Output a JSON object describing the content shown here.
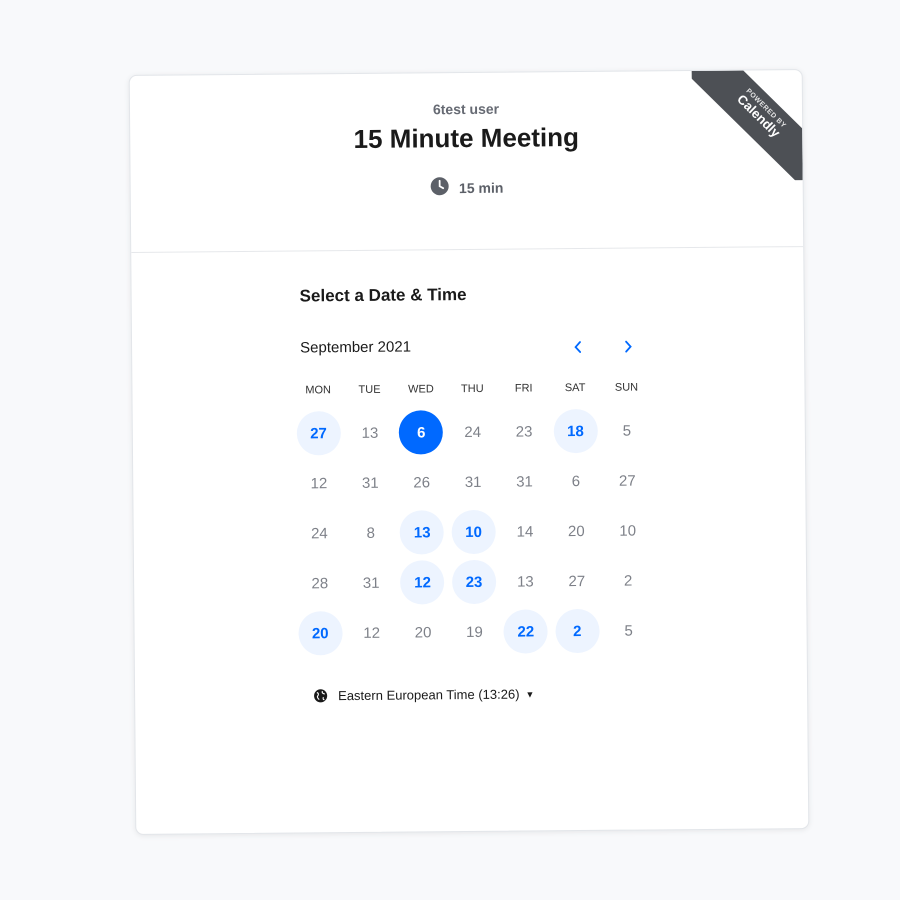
{
  "event": {
    "owner": "6test user",
    "title": "15 Minute Meeting",
    "duration": "15 min"
  },
  "badge": {
    "powered_by": "POWERED BY",
    "brand": "Calendly"
  },
  "calendar": {
    "section_title": "Select a Date & Time",
    "month_label": "September 2021",
    "weekdays": [
      "MON",
      "TUE",
      "WED",
      "THU",
      "FRI",
      "SAT",
      "SUN"
    ],
    "days": [
      {
        "label": "27",
        "state": "available"
      },
      {
        "label": "13",
        "state": "unavailable"
      },
      {
        "label": "6",
        "state": "selected"
      },
      {
        "label": "24",
        "state": "unavailable"
      },
      {
        "label": "23",
        "state": "unavailable"
      },
      {
        "label": "18",
        "state": "available"
      },
      {
        "label": "5",
        "state": "unavailable"
      },
      {
        "label": "12",
        "state": "unavailable"
      },
      {
        "label": "31",
        "state": "unavailable"
      },
      {
        "label": "26",
        "state": "unavailable"
      },
      {
        "label": "31",
        "state": "unavailable"
      },
      {
        "label": "31",
        "state": "unavailable"
      },
      {
        "label": "6",
        "state": "unavailable"
      },
      {
        "label": "27",
        "state": "unavailable"
      },
      {
        "label": "24",
        "state": "unavailable"
      },
      {
        "label": "8",
        "state": "unavailable"
      },
      {
        "label": "13",
        "state": "available"
      },
      {
        "label": "10",
        "state": "available"
      },
      {
        "label": "14",
        "state": "unavailable"
      },
      {
        "label": "20",
        "state": "unavailable"
      },
      {
        "label": "10",
        "state": "unavailable"
      },
      {
        "label": "28",
        "state": "unavailable"
      },
      {
        "label": "31",
        "state": "unavailable"
      },
      {
        "label": "12",
        "state": "available"
      },
      {
        "label": "23",
        "state": "available"
      },
      {
        "label": "13",
        "state": "unavailable"
      },
      {
        "label": "27",
        "state": "unavailable"
      },
      {
        "label": "2",
        "state": "unavailable"
      },
      {
        "label": "20",
        "state": "available"
      },
      {
        "label": "12",
        "state": "unavailable"
      },
      {
        "label": "20",
        "state": "unavailable"
      },
      {
        "label": "19",
        "state": "unavailable"
      },
      {
        "label": "22",
        "state": "available"
      },
      {
        "label": "2",
        "state": "available"
      },
      {
        "label": "5",
        "state": "unavailable"
      }
    ]
  },
  "timezone": {
    "label": "Eastern European Time (13:26)"
  },
  "icons": {
    "clock": "clock-icon",
    "globe": "globe-icon",
    "prev": "chevron-left-icon",
    "next": "chevron-right-icon",
    "caret": "caret-down-icon"
  },
  "colors": {
    "accent": "#0069ff",
    "available_bg": "#edf4ff",
    "ribbon": "#4d5055"
  }
}
